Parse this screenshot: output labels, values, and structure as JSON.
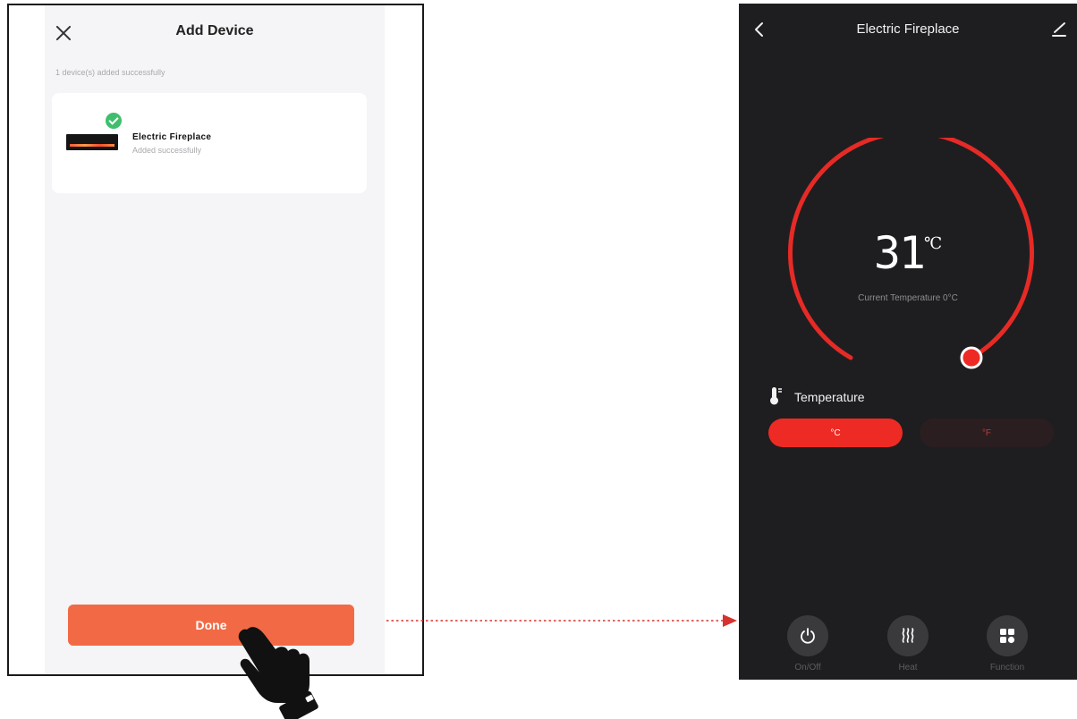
{
  "add_device": {
    "title": "Add Device",
    "added_count_text": "1 device(s) added successfully",
    "device": {
      "name": "Electric Fireplace",
      "status": "Added successfully"
    },
    "done_label": "Done"
  },
  "fireplace": {
    "title": "Electric Fireplace",
    "temperature_value": "31",
    "temperature_unit": "℃",
    "current_temperature_text": "Current Temperature 0°C",
    "temperature_label": "Temperature",
    "unit_options": [
      "°C",
      "°F"
    ],
    "selected_unit": "°C",
    "setpoint_fraction": 0.93,
    "controls": [
      {
        "label": "On/Off",
        "icon": "power-icon"
      },
      {
        "label": "Heat",
        "icon": "heat-icon"
      },
      {
        "label": "Function",
        "icon": "function-grid-icon"
      }
    ]
  },
  "colors": {
    "accent_orange": "#f26a45",
    "accent_red": "#ee2a24",
    "dark_background": "#1e1e20",
    "success_green": "#3fbf6e"
  }
}
